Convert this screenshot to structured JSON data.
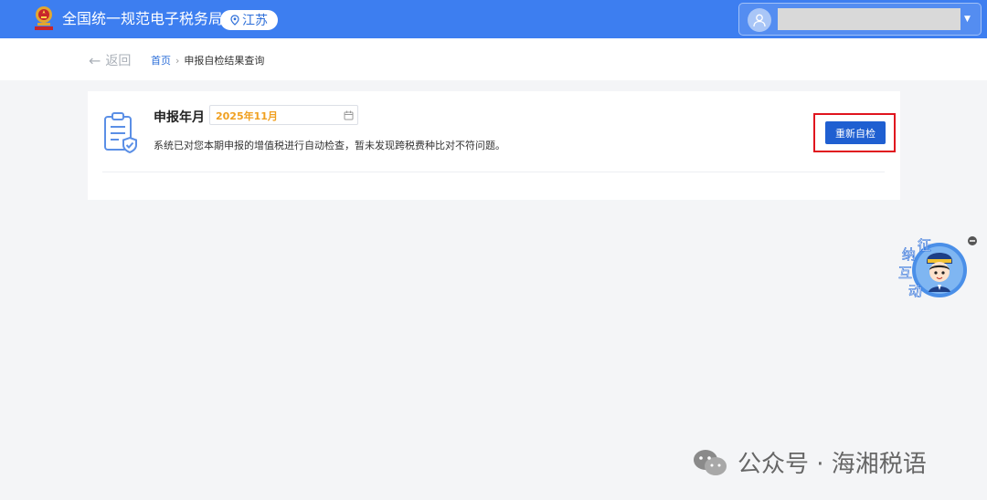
{
  "header": {
    "site_title": "全国统一规范电子税务局",
    "region": "江苏",
    "emblem_icon": "tax-emblem-icon",
    "region_icon": "location-pin-icon",
    "user_avatar_icon": "user-avatar-icon",
    "user_name": "",
    "dropdown_icon": "caret-down-icon"
  },
  "nav": {
    "back_label": "返回",
    "back_icon": "arrow-left-icon",
    "breadcrumb": [
      {
        "label": "首页"
      },
      {
        "label": "申报自检结果查询"
      }
    ],
    "breadcrumb_separator": "›"
  },
  "result_card": {
    "icon": "clipboard-shield-icon",
    "period_label": "申报年月",
    "period_value": "2025年11月",
    "calendar_icon": "calendar-icon",
    "message": "系统已对您本期申报的增值税进行自动检查，暂未发现跨税费种比对不符问题。",
    "recheck_button_label": "重新自检"
  },
  "assistant_widget": {
    "label_chars": [
      "征",
      "纳",
      "互",
      "动"
    ],
    "close_icon": "minus-circle-icon"
  },
  "watermark": {
    "text": "公众号 · 海湘税语",
    "icon": "wechat-icon"
  },
  "colors": {
    "header_bg": "#3d7ef0",
    "primary": "#1f5fd1",
    "highlight": "#e0141e",
    "period_value": "#f0a020"
  }
}
